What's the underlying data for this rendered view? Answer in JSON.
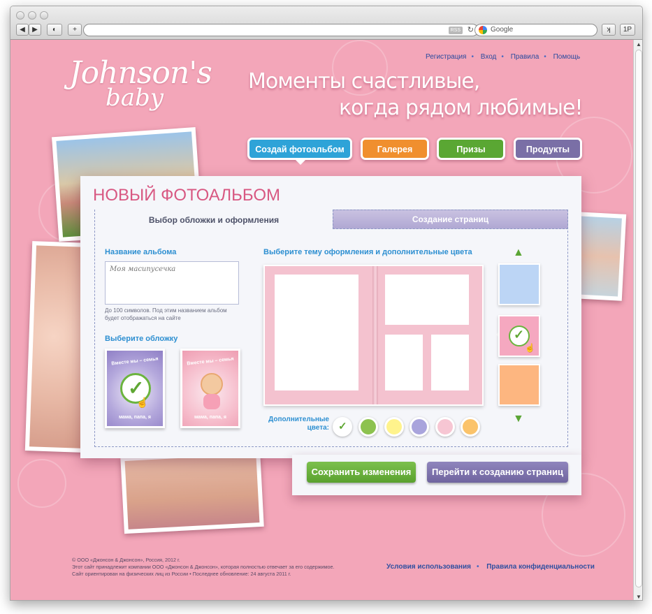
{
  "browser": {
    "search_placeholder": "Google",
    "rss": "RSS",
    "ext1": "ʞ",
    "ext2": "1P"
  },
  "header": {
    "logo_line1": "Johnson's",
    "logo_line2": "baby",
    "links": [
      "Регистрация",
      "Вход",
      "Правила",
      "Помощь"
    ],
    "headline_1": "Моменты счастливые,",
    "headline_2": "когда рядом любимые!"
  },
  "nav": [
    {
      "label": "Создай фотоальбом",
      "color": "#2ea3d8"
    },
    {
      "label": "Галерея",
      "color": "#f08f2e"
    },
    {
      "label": "Призы",
      "color": "#5aa733"
    },
    {
      "label": "Продукты",
      "color": "#7a6fa6"
    }
  ],
  "panel": {
    "title": "НОВЫЙ ФОТОАЛЬБОМ",
    "tab_active": "Выбор обложки и оформления",
    "tab_inactive": "Создание страниц",
    "album_name_label": "Название альбома",
    "album_name_value": "Моя масипусечка",
    "album_name_hint": "До 100 символов. Под этим названием альбом будет отображаться на сайте",
    "cover_label": "Выберите обложку",
    "cover_text_top": "Вместе мы – семья",
    "cover_text_bottom": "мама, папа, я",
    "theme_label": "Выберите тему оформления и дополнительные цвета",
    "extra_colors_label_1": "Дополнительные",
    "extra_colors_label_2": "цвета:",
    "swatches": [
      "#ffffff",
      "#8dc24f",
      "#fff38c",
      "#a9a4dc",
      "#f7c6d3",
      "#fbc36a"
    ],
    "themes": [
      "#bcd5f5",
      "#f5a8c0",
      "#fdb680"
    ]
  },
  "actions": {
    "save": "Сохранить изменения",
    "next": "Перейти к созданию страниц"
  },
  "footer": {
    "line1": "© ООО «Джонсон & Джонсон», Россия, 2012 г.",
    "line2": "Этот сайт принадлежит компании ООО «Джонсон & Джонсон», которая полностью отвечает за его содержимое.",
    "line3": "Сайт ориентирован на физических лиц из России  •  Последнее обновление: 24 августа 2011 г.",
    "terms": "Условия использования",
    "privacy": "Правила конфиденциальности"
  }
}
